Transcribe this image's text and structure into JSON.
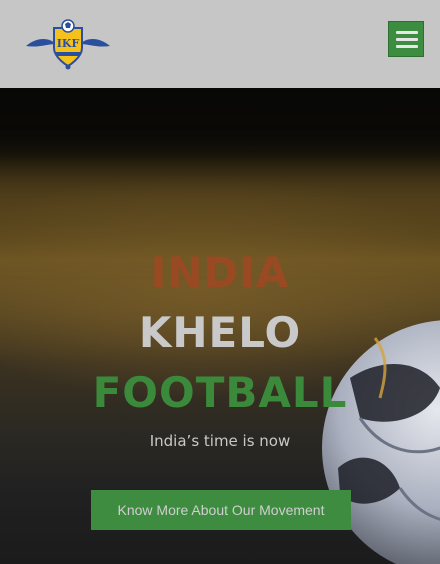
{
  "header": {
    "logo_text": "IKF",
    "menu_icon": "hamburger-menu-icon"
  },
  "hero": {
    "title_line1": "INDIA",
    "title_line2": "KHELO",
    "title_line3": "FOOTBALL",
    "tagline": "India’s time is now",
    "cta_label": "Know More About Our Movement",
    "colors": {
      "line1": "#9a4a23",
      "line2": "#c9c9c9",
      "line3": "#3b8a3c",
      "accent": "#3d8c3f"
    }
  }
}
